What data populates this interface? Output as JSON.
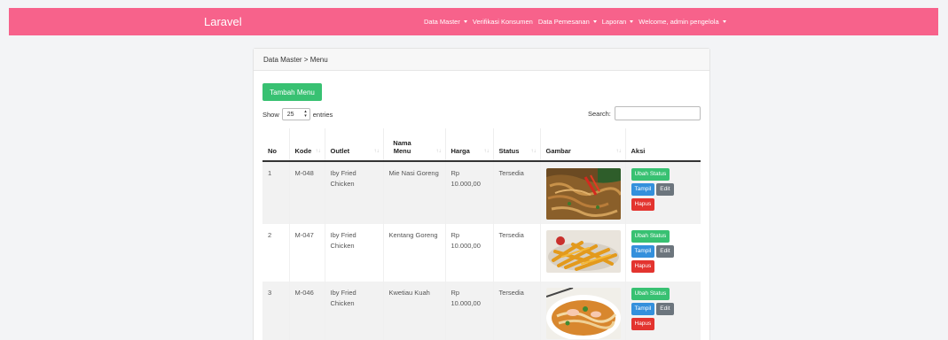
{
  "navbar": {
    "brand": "Laravel",
    "items": [
      {
        "label": "Data Master",
        "dropdown": true
      },
      {
        "label": "Verifikasi Konsumen",
        "dropdown": false
      },
      {
        "label": "Data Pemesanan",
        "dropdown": true
      },
      {
        "label": "Laporan",
        "dropdown": true
      },
      {
        "label": "Welcome, admin pengelola",
        "dropdown": true
      }
    ],
    "color": "#f7628b"
  },
  "breadcrumb": "Data Master > Menu",
  "add_button": "Tambah Menu",
  "length": {
    "show": "Show",
    "value": "25",
    "entries": "entries"
  },
  "search": {
    "label": "Search:",
    "value": ""
  },
  "table": {
    "headers": [
      "No",
      "Kode",
      "Outlet",
      "Nama Menu",
      "Harga",
      "Status",
      "Gambar",
      "Aksi"
    ],
    "rows": [
      {
        "no": "1",
        "kode": "M-048",
        "outlet": "Iby Fried Chicken",
        "nama": "Mie Nasi Goreng",
        "harga": "Rp 10.000,00",
        "status": "Tersedia",
        "gambar": "fried-noodles-image"
      },
      {
        "no": "2",
        "kode": "M-047",
        "outlet": "Iby Fried Chicken",
        "nama": "Kentang Goreng",
        "harga": "Rp 10.000,00",
        "status": "Tersedia",
        "gambar": "french-fries-image"
      },
      {
        "no": "3",
        "kode": "M-046",
        "outlet": "Iby Fried Chicken",
        "nama": "Kwetiau Kuah",
        "harga": "Rp 10.000,00",
        "status": "Tersedia",
        "gambar": "noodle-soup-image"
      }
    ]
  },
  "actions": {
    "status": "Ubah Status",
    "show": "Tampil",
    "edit": "Edit",
    "delete": "Hapus"
  },
  "colors": {
    "green": "#38c172",
    "blue": "#3490dc",
    "gray": "#6c757d",
    "red": "#e3342f"
  }
}
